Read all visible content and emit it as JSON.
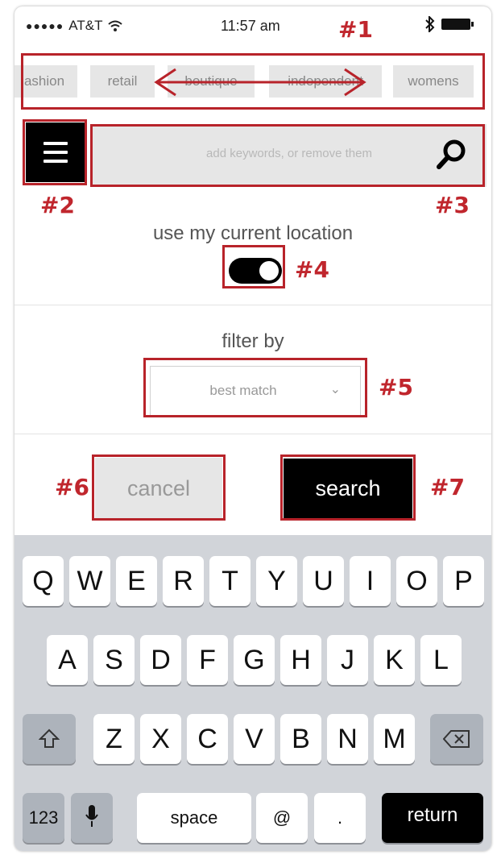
{
  "status_bar": {
    "signal_dots": "●●●●●",
    "carrier": "AT&T",
    "time": "11:57 am"
  },
  "annotations": {
    "a1": "#1",
    "a2": "#2",
    "a3": "#3",
    "a4": "#4",
    "a5": "#5",
    "a6": "#6",
    "a7": "#7"
  },
  "tags": [
    "ashion",
    "retail",
    "boutique",
    "independent",
    "womens"
  ],
  "search": {
    "placeholder": "add keywords, or remove them"
  },
  "location": {
    "label": "use my current location",
    "enabled": true
  },
  "filter": {
    "label": "filter by",
    "selected": "best match"
  },
  "buttons": {
    "cancel": "cancel",
    "search": "search"
  },
  "keyboard": {
    "row1": [
      "Q",
      "W",
      "E",
      "R",
      "T",
      "Y",
      "U",
      "I",
      "O",
      "P"
    ],
    "row2": [
      "A",
      "S",
      "D",
      "F",
      "G",
      "H",
      "J",
      "K",
      "L"
    ],
    "row3": [
      "Z",
      "X",
      "C",
      "V",
      "B",
      "N",
      "M"
    ],
    "num_key": "123",
    "space_key": "space",
    "at_key": "@",
    "period_key": ".",
    "return_key": "return"
  },
  "colors": {
    "annotation_red": "#b8232a",
    "accent_black": "#000000",
    "field_gray": "#e6e6e6"
  },
  "icons": [
    "wifi-icon",
    "bluetooth-icon",
    "battery-icon",
    "menu-icon",
    "search-icon",
    "swipe-arrow-icon",
    "chevron-down-icon",
    "shift-icon",
    "mic-icon",
    "backspace-icon"
  ]
}
